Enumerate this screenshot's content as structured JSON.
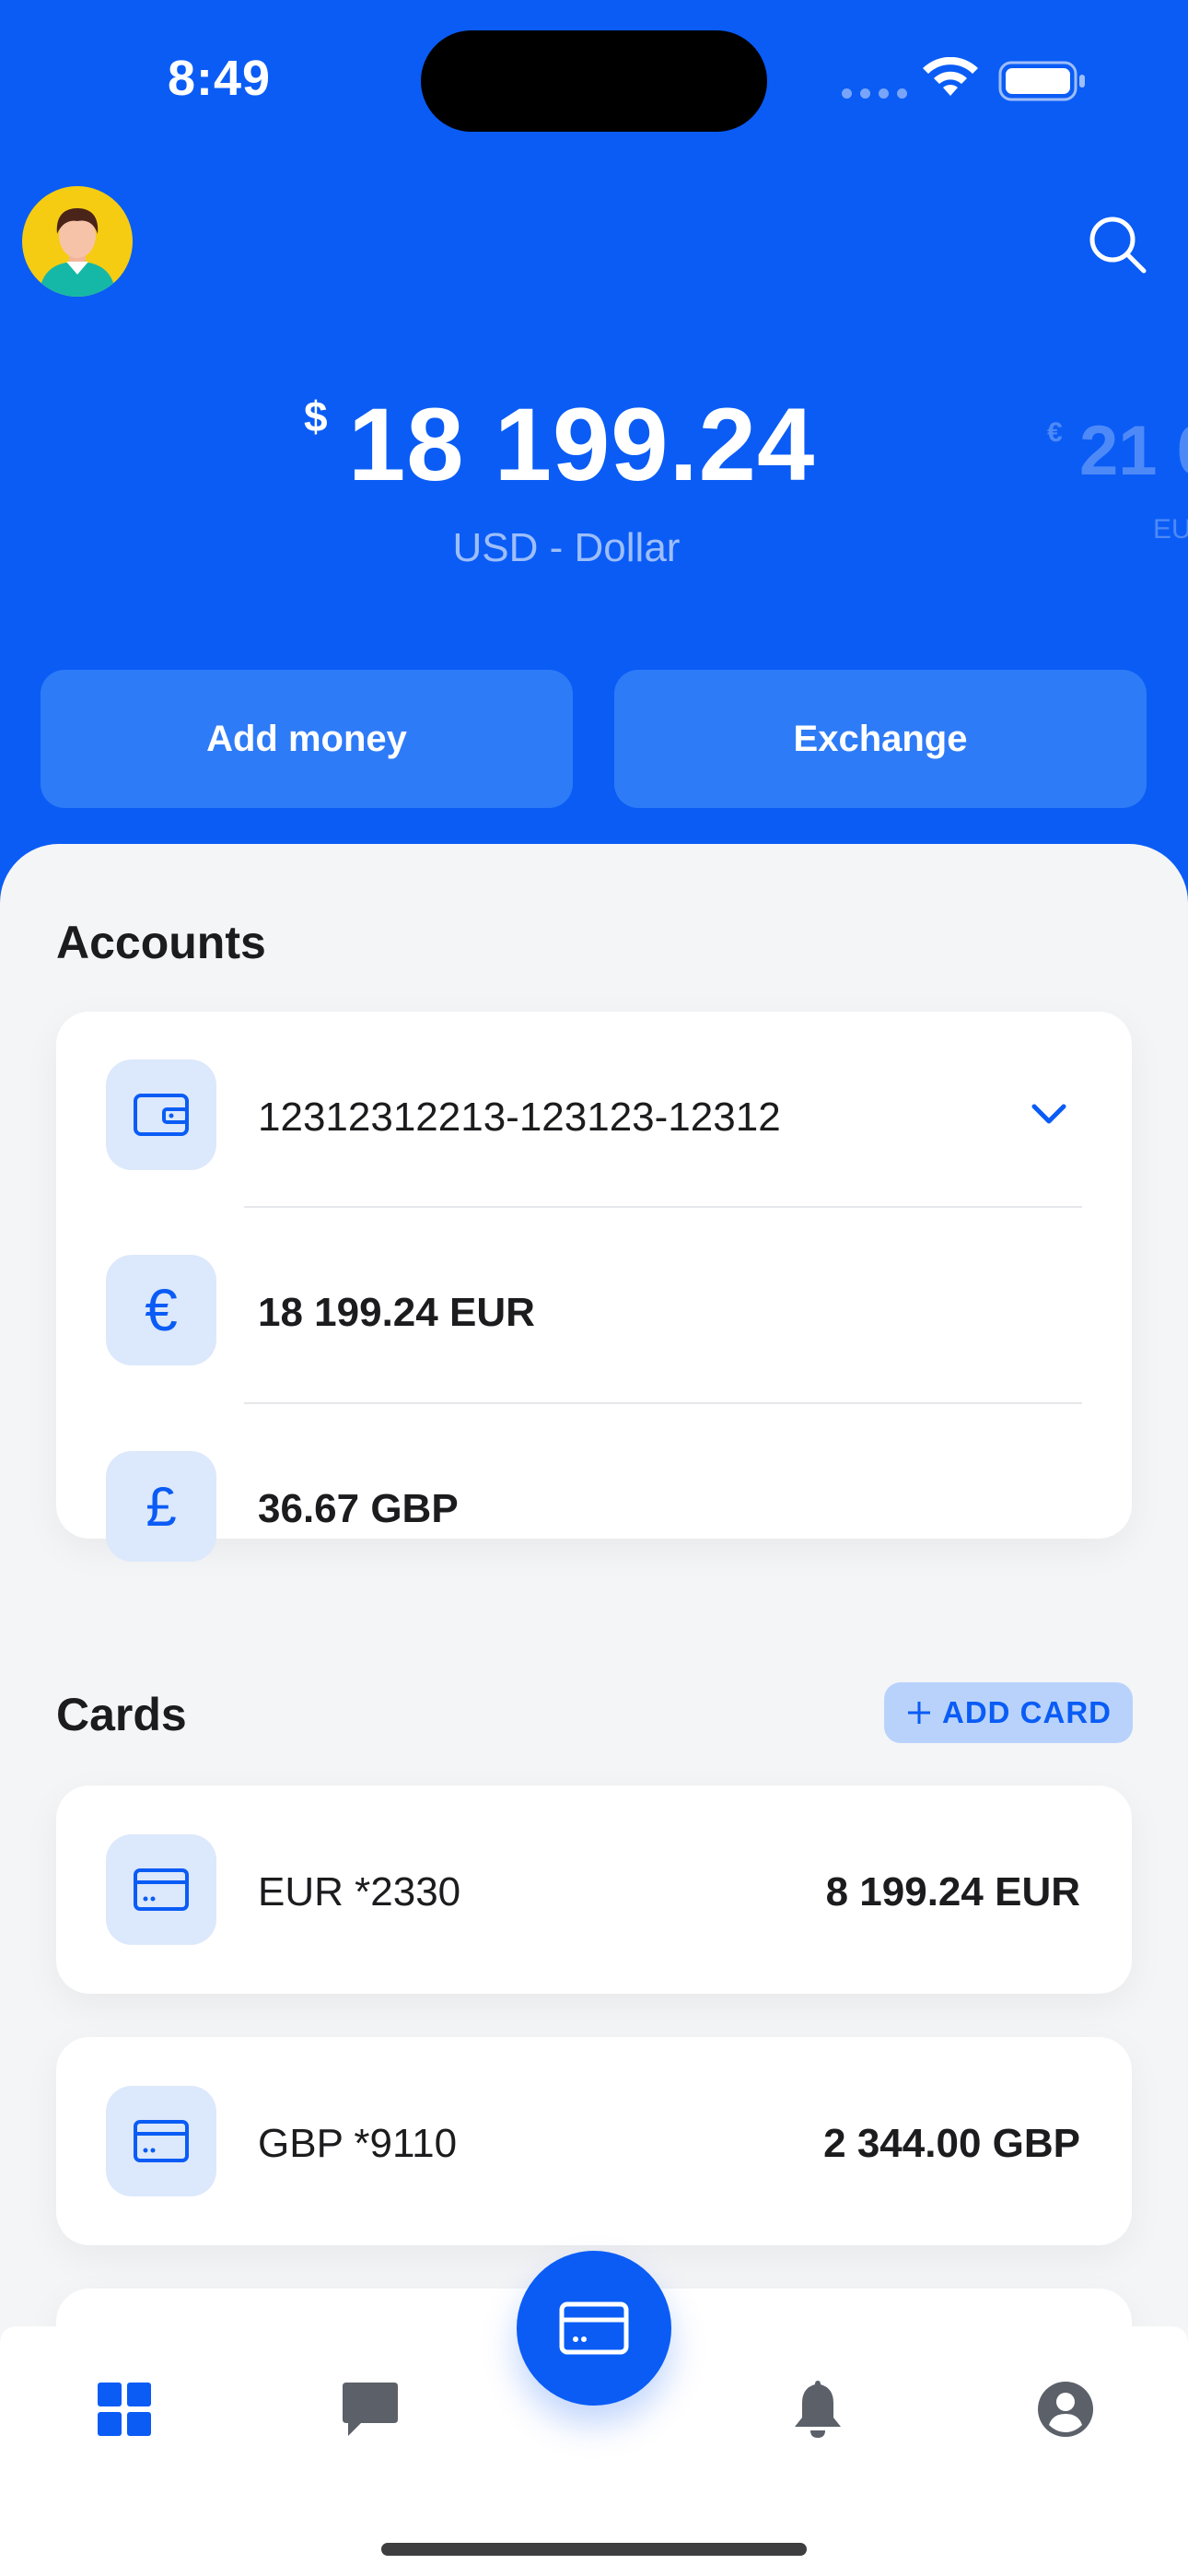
{
  "status_bar": {
    "time": "8:49"
  },
  "header": {
    "avatar_icon": "user-avatar",
    "search_icon": "search-icon"
  },
  "balance": {
    "primary": {
      "symbol": "$",
      "amount": "18 199.24",
      "currency": "USD - Dollar"
    },
    "next": {
      "symbol": "€",
      "amount": "21 0",
      "currency": "EU"
    }
  },
  "actions": {
    "add_money": "Add money",
    "exchange": "Exchange"
  },
  "accounts": {
    "title": "Accounts",
    "number": "12312312213-123123-12312",
    "balances": [
      {
        "symbol": "€",
        "label": "18 199.24 EUR"
      },
      {
        "symbol": "£",
        "label": "36.67 GBP"
      }
    ]
  },
  "cards": {
    "title": "Cards",
    "add_label": "ADD CARD",
    "items": [
      {
        "name": "EUR *2330",
        "amount": "8 199.24 EUR"
      },
      {
        "name": "GBP *9110",
        "amount": "2 344.00 GBP"
      }
    ]
  },
  "colors": {
    "primary": "#0A5CF5",
    "tile": "#DCE8FB",
    "sheet": "#F4F5F7"
  }
}
